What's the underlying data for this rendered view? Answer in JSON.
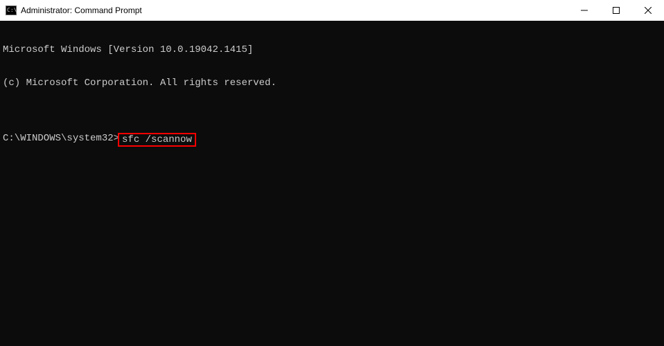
{
  "titlebar": {
    "icon_label": "C:\\",
    "title": "Administrator: Command Prompt"
  },
  "controls": {
    "minimize": "—",
    "maximize": "▢",
    "close": "✕"
  },
  "terminal": {
    "line1": "Microsoft Windows [Version 10.0.19042.1415]",
    "line2": "(c) Microsoft Corporation. All rights reserved.",
    "blank": "",
    "prompt": "C:\\WINDOWS\\system32>",
    "command": "sfc /scannow"
  }
}
